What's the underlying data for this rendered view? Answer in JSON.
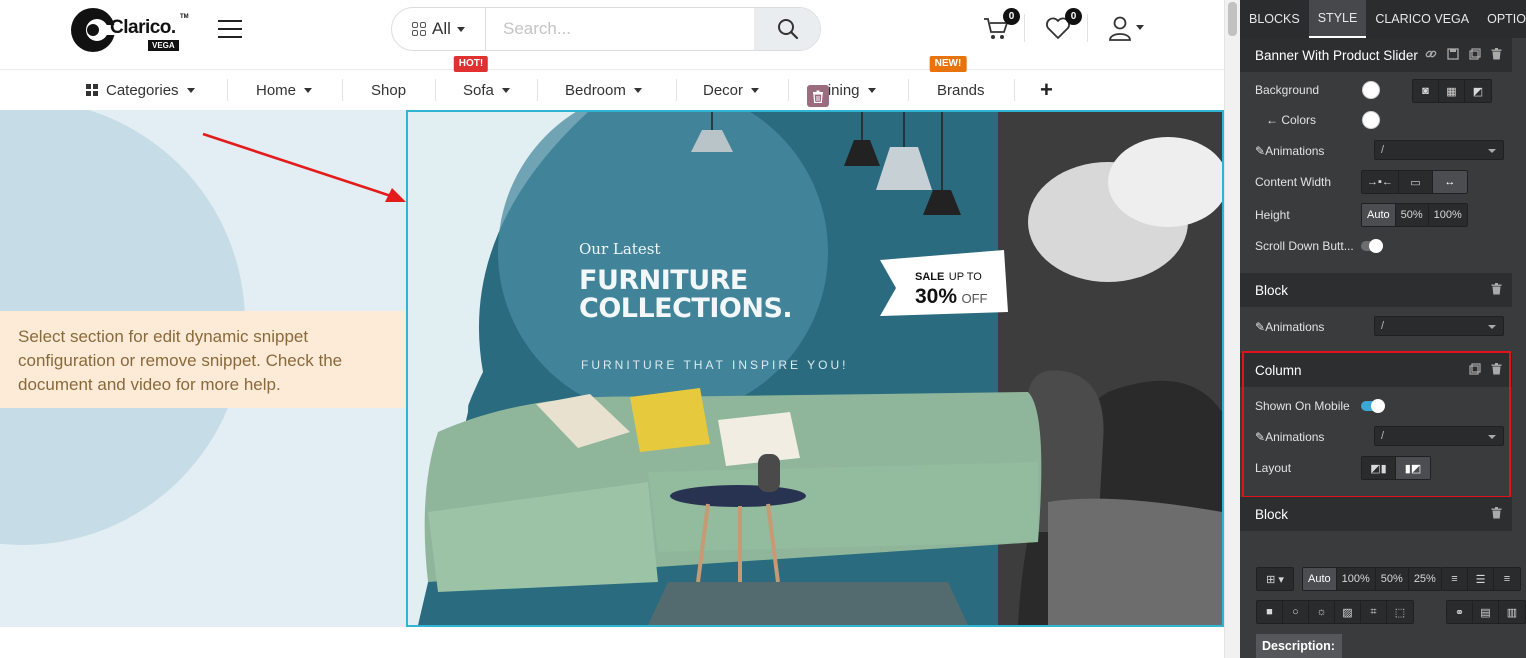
{
  "header": {
    "logo_text": "Clarico.",
    "logo_sub": "VEGA",
    "logo_tm": "TM",
    "search": {
      "category_label": "All",
      "placeholder": "Search..."
    },
    "cart_count": "0",
    "wishlist_count": "0"
  },
  "menu": {
    "items": [
      {
        "label": "Categories"
      },
      {
        "label": "Home"
      },
      {
        "label": "Shop"
      },
      {
        "label": "Sofa",
        "badge": "HOT!"
      },
      {
        "label": "Bedroom"
      },
      {
        "label": "Decor"
      },
      {
        "label": "Dining"
      },
      {
        "label": "Brands",
        "badge": "NEW!"
      }
    ],
    "add_label": "+"
  },
  "hint": {
    "text": "Select section for edit dynamic snippet configuration or remove snippet. Check the document and video for more help."
  },
  "banner": {
    "eyebrow": "Our Latest",
    "title_line1": "FURNITURE",
    "title_line2": "COLLECTIONS.",
    "tagline": "FURNITURE THAT INSPIRE YOU!",
    "sale_word": "SALE",
    "sale_prefix": "UP TO",
    "sale_value": "30%",
    "sale_suffix": "OFF"
  },
  "panel": {
    "tabs": [
      "BLOCKS",
      "STYLE",
      "CLARICO VEGA",
      "OPTIONS"
    ],
    "active_tab": "STYLE",
    "section1": {
      "title": "Banner With Product Slider",
      "background_label": "Background",
      "colors_label": "← Colors",
      "animations_label": "Animations",
      "animations_value": "/",
      "content_width_label": "Content Width",
      "height_label": "Height",
      "height_options": [
        "Auto",
        "50%",
        "100%"
      ],
      "scroll_down_label": "Scroll Down Butt..."
    },
    "section2": {
      "title": "Block",
      "animations_label": "Animations",
      "animations_value": "/"
    },
    "section3": {
      "title": "Column",
      "shown_on_mobile_label": "Shown On Mobile",
      "shown_on_mobile": true,
      "animations_label": "Animations",
      "animations_value": "/",
      "layout_label": "Layout"
    },
    "section4": {
      "title": "Block"
    },
    "bottom_toolbar": {
      "size_options": [
        "Auto",
        "100%",
        "50%",
        "25%"
      ]
    },
    "description_label": "Description:"
  },
  "colors": {
    "accent_teal": "#2fb4d3",
    "hot_badge": "#e03131",
    "new_badge": "#e8730c",
    "panel_bg": "#3a3b3d",
    "highlight_red": "#e0131b",
    "hint_bg": "#fdebd8"
  }
}
